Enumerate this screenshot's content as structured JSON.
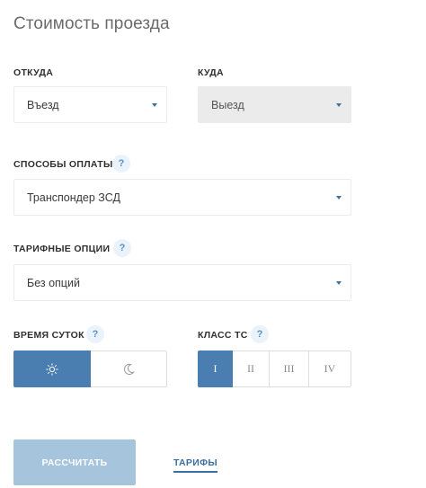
{
  "title": "Стоимость проезда",
  "from": {
    "label": "ОТКУДА",
    "value": "Въезд"
  },
  "to": {
    "label": "КУДА",
    "value": "Выезд"
  },
  "payment": {
    "label": "СПОСОБЫ ОПЛАТЫ",
    "help": "?",
    "value": "Транспондер ЗСД"
  },
  "tariff": {
    "label": "ТАРИФНЫЕ ОПЦИИ",
    "help": "?",
    "value": "Без опций"
  },
  "time_of_day": {
    "label": "ВРЕМЯ СУТОК",
    "help": "?",
    "options": [
      {
        "icon": "sun-icon",
        "selected": true
      },
      {
        "icon": "moon-icon",
        "selected": false
      }
    ]
  },
  "vehicle_class": {
    "label": "КЛАСС ТС",
    "help": "?",
    "options": [
      "I",
      "II",
      "III",
      "IV"
    ],
    "selected": "I"
  },
  "calculate_label": "РАССЧИТАТЬ",
  "tariffs_link": "ТАРИФЫ",
  "colors": {
    "accent": "#4a7db0",
    "button_disabled": "#a6c4dc",
    "help_bg": "#eaf3fb"
  }
}
